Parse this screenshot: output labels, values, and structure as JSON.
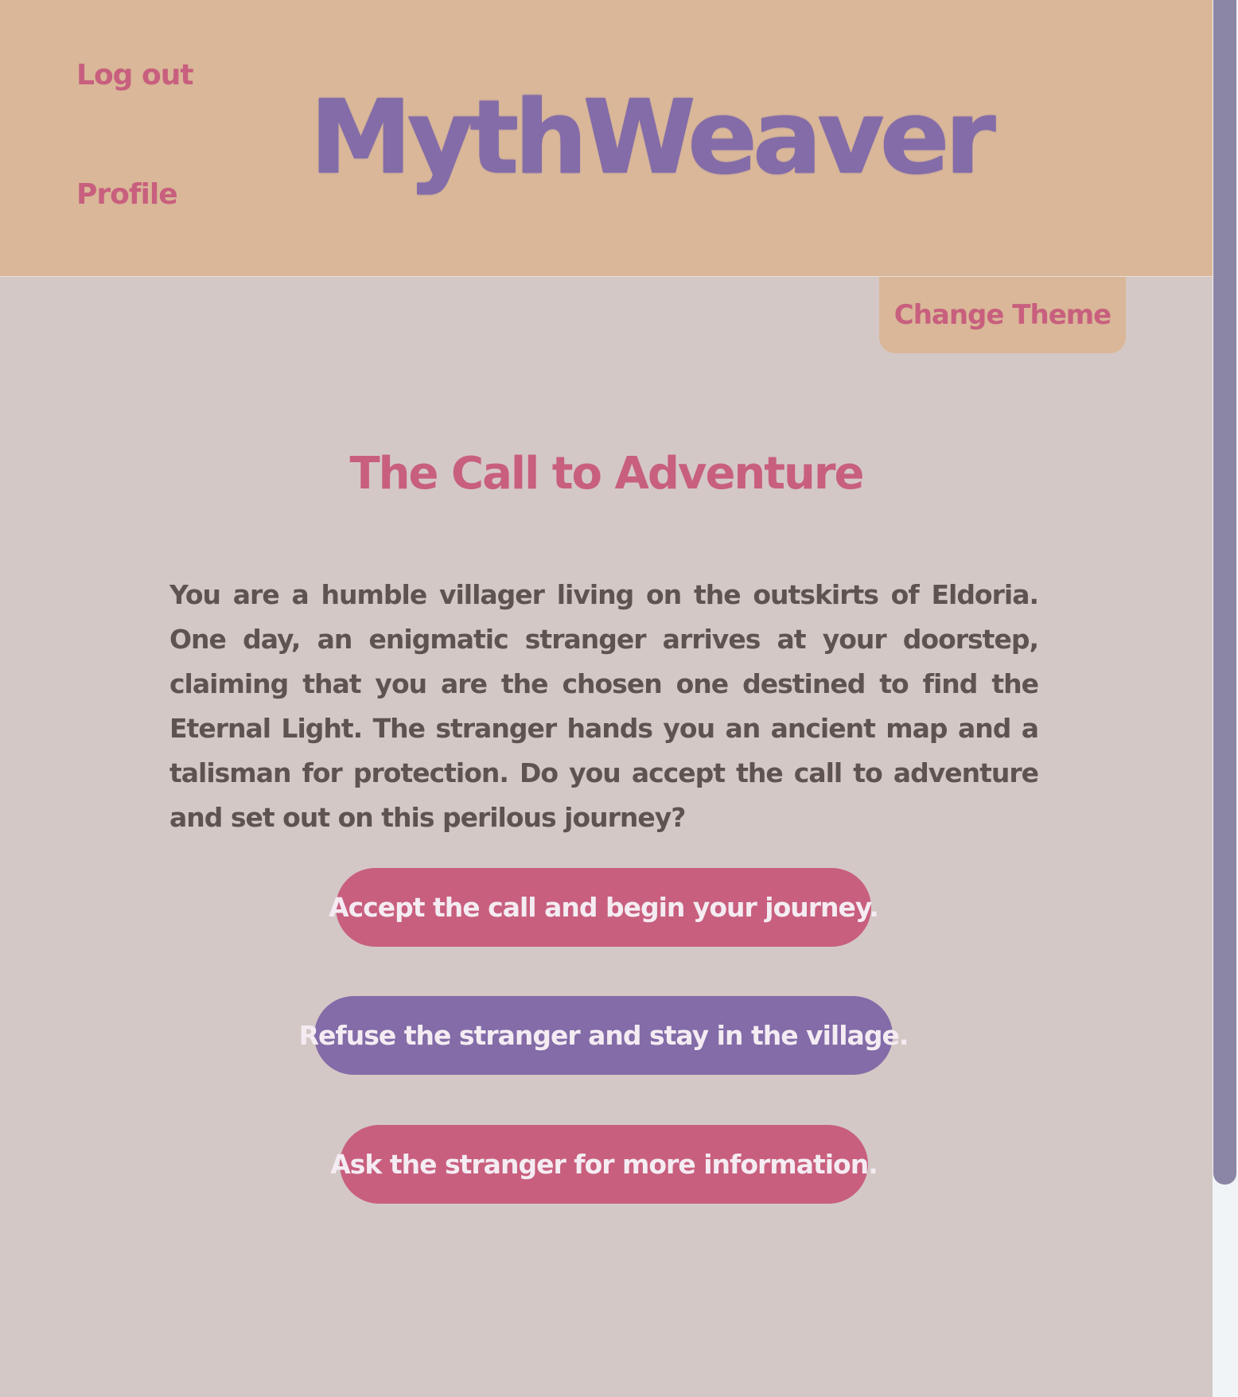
{
  "header": {
    "site_title": "MythWeaver",
    "nav": {
      "logout_label": "Log out",
      "profile_label": "Profile"
    }
  },
  "theme": {
    "change_theme_label": "Change Theme"
  },
  "story": {
    "title": "The Call to Adventure",
    "text": "You are a humble villager living on the outskirts of Eldoria. One day, an enigmatic stranger arrives at your doorstep, claiming that you are the chosen one destined to find the Eternal Light. The stranger hands you an ancient map and a talisman for protection. Do you accept the call to adventure and set out on this perilous journey?",
    "choices": [
      {
        "label": "Accept the call and begin your journey."
      },
      {
        "label": "Refuse the stranger and stay in the village."
      },
      {
        "label": "Ask the stranger for more information."
      }
    ]
  },
  "colors": {
    "background": "#d4c8c6",
    "header_bg": "#d9b798",
    "accent_pink": "#c85f7e",
    "accent_purple": "#836ca8",
    "body_text": "#5d5452",
    "button_text": "#f4ecf2",
    "scrollbar_thumb": "#8c86a6",
    "scrollbar_track": "#f1f4f7"
  }
}
